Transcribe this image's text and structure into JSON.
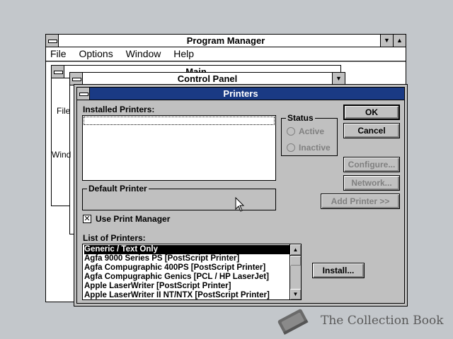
{
  "program_manager": {
    "title": "Program Manager",
    "menu": [
      "File",
      "Options",
      "Window",
      "Help"
    ]
  },
  "main_window": {
    "title": "Main"
  },
  "control_panel": {
    "title": "Control Panel",
    "menu_fragments": [
      "File",
      "Wind"
    ]
  },
  "printers_dialog": {
    "title": "Printers",
    "installed_label": "Installed Printers:",
    "status_group": "Status",
    "status_active": "Active",
    "status_inactive": "Inactive",
    "default_group": "Default Printer",
    "use_print_manager": "Use Print Manager",
    "list_label": "List of Printers:",
    "printers": [
      "Generic / Text Only",
      "Agfa 9000 Series PS [PostScript Printer]",
      "Agfa Compugraphic 400PS [PostScript Printer]",
      "Agfa Compugraphic Genics [PCL / HP LaserJet]",
      "Apple LaserWriter [PostScript Printer]",
      "Apple LaserWriter II NT/NTX [PostScript Printer]"
    ],
    "buttons": {
      "ok": "OK",
      "cancel": "Cancel",
      "configure": "Configure...",
      "network": "Network...",
      "add_printer": "Add Printer >>",
      "install": "Install..."
    }
  },
  "watermark": {
    "text": "The Collection Book"
  }
}
